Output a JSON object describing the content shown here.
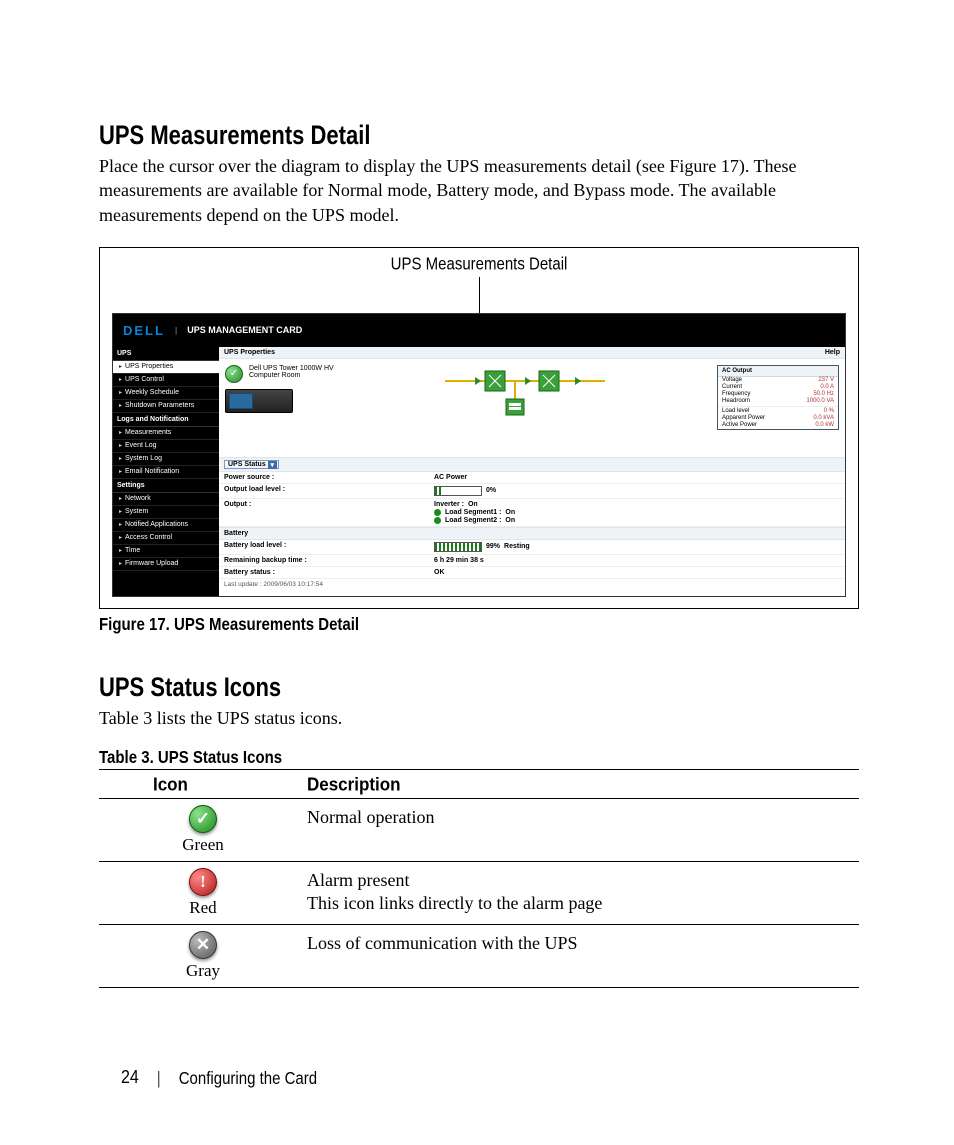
{
  "sections": {
    "measurements_title": "UPS Measurements Detail",
    "measurements_body": "Place the cursor over the diagram to display the UPS measurements detail (see Figure 17). These measurements are available for Normal mode, Battery mode, and Bypass mode. The available measurements depend on the UPS model.",
    "callout": "UPS Measurements Detail",
    "figure_caption": "Figure 17. UPS Measurements Detail",
    "status_title": "UPS Status Icons",
    "status_body": "Table 3 lists the UPS status icons.",
    "table_caption": "Table 3. UPS Status Icons"
  },
  "screenshot": {
    "brand": "DELL",
    "product": "UPS MANAGEMENT CARD",
    "sidebar": {
      "groups": [
        {
          "head": "UPS",
          "items": [
            "UPS Properties",
            "UPS Control",
            "Weekly Schedule",
            "Shutdown Parameters"
          ]
        },
        {
          "head": "Logs and Notification",
          "items": [
            "Measurements",
            "Event Log",
            "System Log",
            "Email Notification"
          ]
        },
        {
          "head": "Settings",
          "items": [
            "Network",
            "System",
            "Notified Applications",
            "Access Control",
            "Time",
            "Firmware Upload"
          ]
        }
      ],
      "active": "UPS Properties"
    },
    "content": {
      "title": "UPS Properties",
      "help": "Help",
      "device_name": "Dell UPS Tower 1000W HV",
      "device_room": "Computer Room",
      "tooltip": {
        "head": "AC Output",
        "rows1": [
          {
            "label": "Voltage",
            "value": "237 V"
          },
          {
            "label": "Current",
            "value": "0.0 A"
          },
          {
            "label": "Frequency",
            "value": "50.0 Hz"
          },
          {
            "label": "Headroom",
            "value": "1000.0 VA"
          }
        ],
        "rows2": [
          {
            "label": "Load level",
            "value": "0 %"
          },
          {
            "label": "Apparent Power",
            "value": "0.0 kVA"
          },
          {
            "label": "Active Power",
            "value": "0.0 kW"
          }
        ]
      },
      "ups_status_label": "UPS Status",
      "rows": {
        "power_source_label": "Power source :",
        "power_source_value": "AC Power",
        "output_load_label": "Output load level :",
        "output_load_value": "0%",
        "output_label": "Output :",
        "output_lines": [
          {
            "label": "Inverter :",
            "value": "On"
          },
          {
            "label": "Load Segment1 :",
            "value": "On"
          },
          {
            "label": "Load Segment2 :",
            "value": "On"
          }
        ],
        "battery_head": "Battery",
        "battery_load_label": "Battery load level :",
        "battery_load_value": "99%",
        "battery_load_state": "Resting",
        "remaining_label": "Remaining backup time :",
        "remaining_value": "6 h 29 min 38 s",
        "battery_status_label": "Battery status :",
        "battery_status_value": "OK",
        "last_update": "Last update : 2009/06/03 10:17:54"
      }
    }
  },
  "status_table": {
    "headers": {
      "icon": "Icon",
      "desc": "Description"
    },
    "rows": [
      {
        "color": "Green",
        "desc1": "Normal operation",
        "desc2": ""
      },
      {
        "color": "Red",
        "desc1": "Alarm present",
        "desc2": "This icon links directly to the alarm page"
      },
      {
        "color": "Gray",
        "desc1": "Loss of communication with the UPS",
        "desc2": ""
      }
    ]
  },
  "footer": {
    "page": "24",
    "section": "Configuring the Card"
  }
}
